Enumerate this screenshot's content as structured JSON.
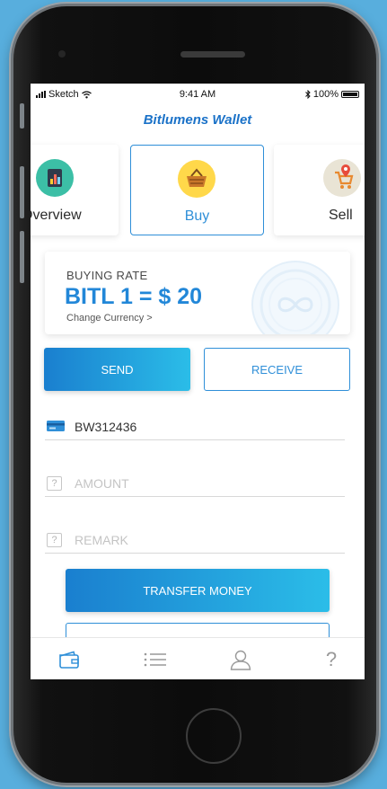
{
  "status_bar": {
    "carrier": "Sketch",
    "time": "9:41 AM",
    "battery": "100%"
  },
  "app": {
    "title": "Bitlumens Wallet"
  },
  "categories": [
    {
      "label": "Overview",
      "icon": "overview-chart-icon"
    },
    {
      "label": "Buy",
      "icon": "shopping-basket-icon",
      "selected": true
    },
    {
      "label": "Sell",
      "icon": "cart-location-icon"
    }
  ],
  "rate_card": {
    "title": "BUYING RATE",
    "value": "BITL 1 = $ 20",
    "link": "Change Currency >"
  },
  "actions": {
    "send": "SEND",
    "receive": "RECEIVE",
    "selected": "send"
  },
  "form": {
    "account": {
      "value": "BW312436",
      "icon": "card-icon"
    },
    "amount": {
      "placeholder": "AMOUNT",
      "icon": "question-box-icon"
    },
    "remark": {
      "placeholder": "REMARK",
      "icon": "question-box-icon"
    },
    "submit": "TRANSFER MONEY"
  },
  "tabs": [
    {
      "name": "wallet",
      "icon": "wallet-icon",
      "active": true
    },
    {
      "name": "list",
      "icon": "list-icon"
    },
    {
      "name": "profile",
      "icon": "user-icon"
    },
    {
      "name": "help",
      "icon": "question-mark-icon",
      "glyph": "?"
    }
  ],
  "colors": {
    "background": "#58aedd",
    "accent": "#2f8fd8",
    "gradient_start": "#1a7fcf",
    "gradient_end": "#2bbde8"
  }
}
